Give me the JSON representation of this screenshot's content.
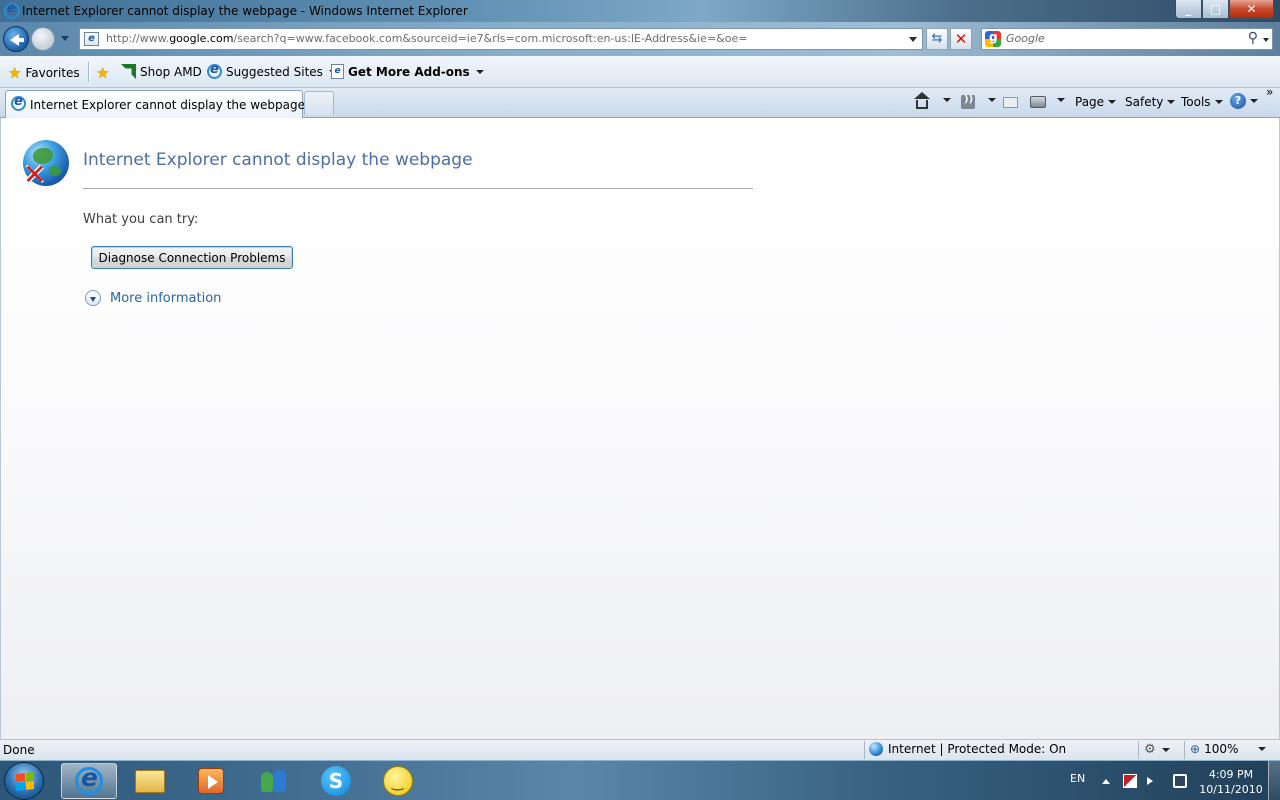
{
  "window": {
    "title": "Internet Explorer cannot display the webpage - Windows Internet Explorer",
    "min_glyph": "_",
    "max_glyph": "□",
    "close_glyph": "✕"
  },
  "address": {
    "url_prefix": "http://www.",
    "url_domain": "google.com",
    "url_suffix": "/search?q=www.facebook.com&sourceid=ie7&rls=com.microsoft:en-us:IE-Address&ie=&oe=",
    "refresh_glyph": "⇆",
    "stop_glyph": "✕"
  },
  "search": {
    "placeholder": "Google",
    "search_glyph": "⚲"
  },
  "favorites_bar": {
    "favorites_label": "Favorites",
    "items": [
      {
        "label": "Shop AMD"
      },
      {
        "label": "Suggested Sites"
      },
      {
        "label": "Get More Add-ons"
      }
    ]
  },
  "tabs": {
    "active_label": "Internet Explorer cannot display the webpage"
  },
  "command_bar": {
    "page_label": "Page",
    "safety_label": "Safety",
    "tools_label": "Tools",
    "help_glyph": "?",
    "overflow_glyph": "»"
  },
  "error_page": {
    "title": "Internet Explorer cannot display the webpage",
    "try_label": "What you can try:",
    "diagnose_button": "Diagnose Connection Problems",
    "more_info": "More information"
  },
  "status_bar": {
    "status": "Done",
    "zone": "Internet | Protected Mode: On",
    "zoom": "100%",
    "zoom_glyph": "⊕"
  },
  "taskbar": {
    "language": "EN",
    "skype_glyph": "S",
    "time": "4:09 PM",
    "date": "10/11/2010"
  },
  "colors": {
    "link": "#2c66a0",
    "heading": "#4c6fa4"
  }
}
